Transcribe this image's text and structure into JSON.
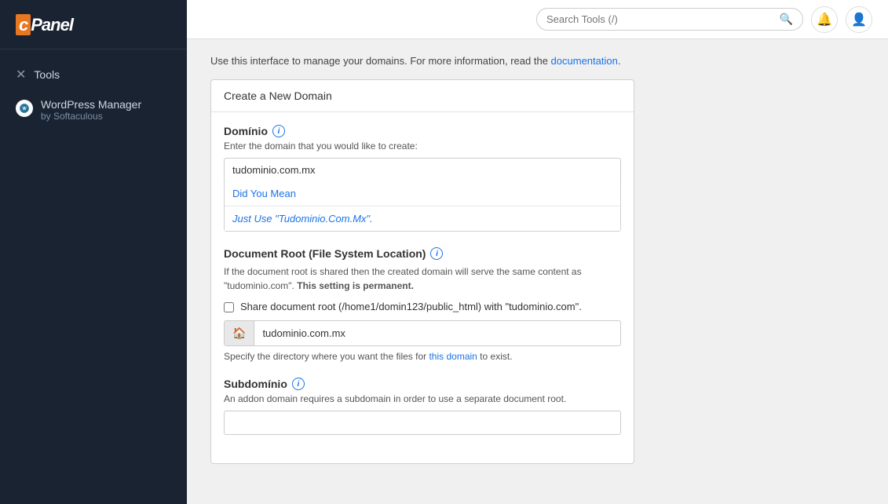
{
  "sidebar": {
    "logo": "cPanel",
    "logo_c": "c",
    "items": [
      {
        "id": "tools",
        "label": "Tools",
        "icon": "✕"
      },
      {
        "id": "wordpress-manager",
        "label": "WordPress Manager",
        "sublabel": "by Softaculous",
        "icon": "wp"
      }
    ]
  },
  "header": {
    "search_placeholder": "Search Tools (/)",
    "search_value": ""
  },
  "content": {
    "intro": "Use this interface to manage your domains. For more information, read the ",
    "intro_link": "documentation",
    "intro_end": ".",
    "form_title": "Create a New Domain",
    "domain_field": {
      "label": "Domínio",
      "description": "Enter the domain that you would like to create:",
      "value": "tudominio.com.mx",
      "did_you_mean_label": "Did You Mean",
      "suggestion_link": "Just Use \"Tudominio.Com.Mx\"."
    },
    "document_root_field": {
      "label": "Document Root (File System Location)",
      "description_1": "If the document root is shared then the created domain will serve the same content as \"tudominio.com\".",
      "description_bold": "This setting is permanent.",
      "checkbox_label": "Share document root (/home1/domin123/public_html) with \"tudominio.com\".",
      "value": "tudominio.com.mx",
      "hint": "Specify the directory where you want the files for this domain to exist."
    },
    "subdomain_field": {
      "label": "Subdomínio",
      "description": "An addon domain requires a subdomain in order to use a separate document root."
    }
  }
}
